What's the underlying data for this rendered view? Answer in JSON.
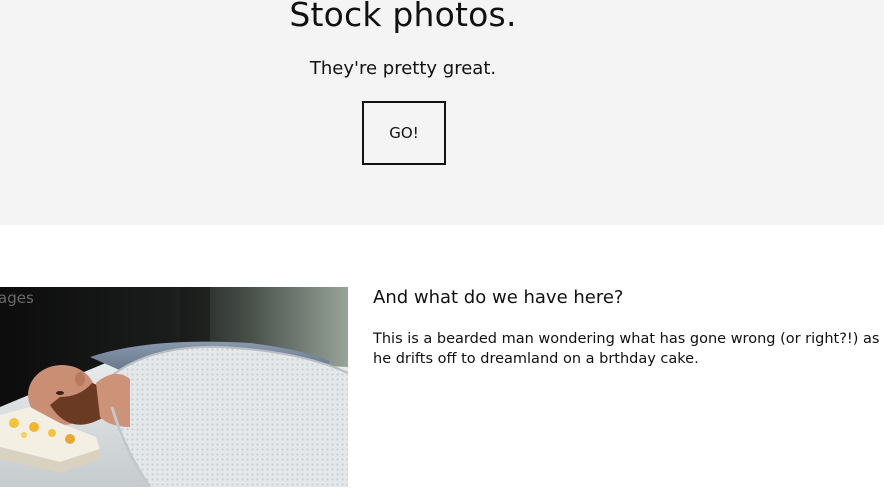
{
  "hero": {
    "title": "Stock photos.",
    "subtitle": "They're pretty great.",
    "button_label": "GO!"
  },
  "feature": {
    "image_watermark": "ages",
    "heading": "And what do we have here?",
    "body": "This is a bearded man wondering what has gone wrong (or right?!) as he drifts off to dreamland on a brthday cake."
  },
  "colors": {
    "hero_background": "#f4f4f4",
    "page_background": "#ffffff",
    "text": "#111111"
  }
}
